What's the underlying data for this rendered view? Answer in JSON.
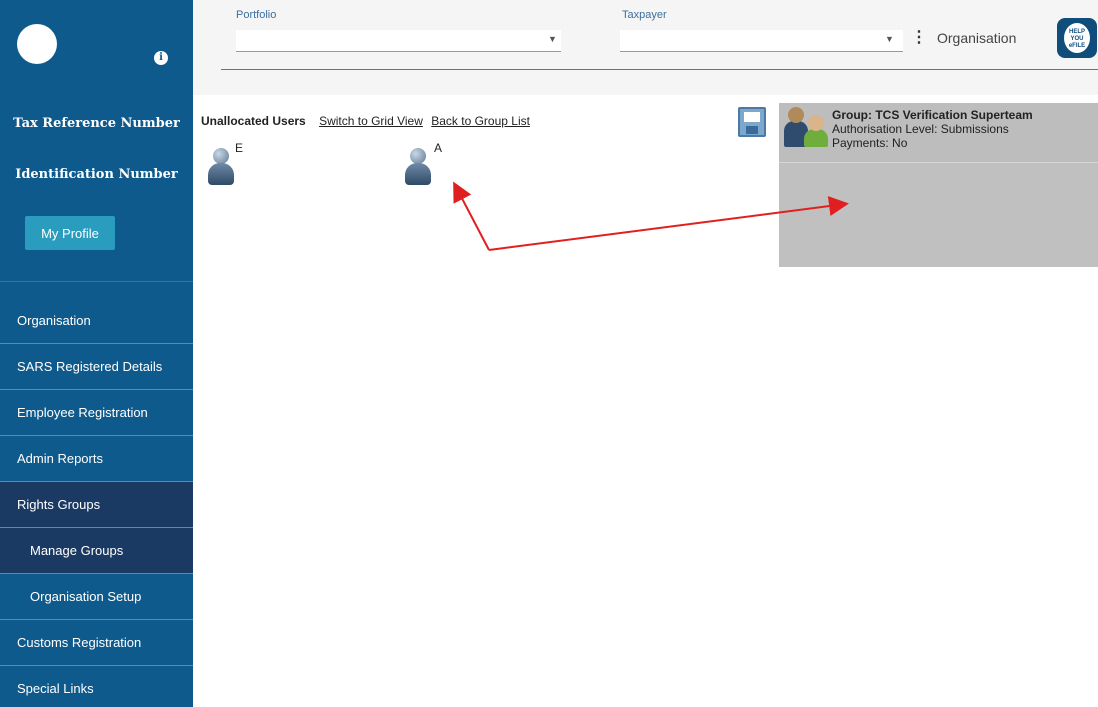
{
  "sidebar": {
    "tax_reference_label": "Tax Reference Number",
    "identification_label": "Identification Number",
    "profile_button": "My Profile",
    "info_icon": "info-icon",
    "nav": [
      {
        "label": "Organisation"
      },
      {
        "label": "SARS Registered Details"
      },
      {
        "label": "Employee Registration"
      },
      {
        "label": "Admin Reports"
      },
      {
        "label": "Rights Groups"
      },
      {
        "label": "Manage Groups"
      },
      {
        "label": "Organisation Setup"
      },
      {
        "label": "Customs Registration"
      },
      {
        "label": "Special Links"
      }
    ]
  },
  "topbar": {
    "portfolio_label": "Portfolio",
    "portfolio_value": "",
    "taxpayer_label": "Taxpayer",
    "taxpayer_value": "",
    "organisation_label": "Organisation",
    "help_badge_text": "HELP YOU eFILE"
  },
  "main": {
    "title": "Unallocated Users",
    "switch_link": "Switch to Grid View",
    "back_link": "Back to Group List",
    "users": [
      {
        "name": "E"
      },
      {
        "name": "A"
      }
    ],
    "group": {
      "title": "Group: TCS Verification Superteam",
      "authorisation": "Authorisation Level: Submissions",
      "payments": "Payments: No"
    }
  },
  "colors": {
    "sidebar": "#0f5a8c",
    "sidebar_active": "#1b3a63",
    "profile_button": "#2a9cbd",
    "annotation_arrow": "#e02020"
  }
}
